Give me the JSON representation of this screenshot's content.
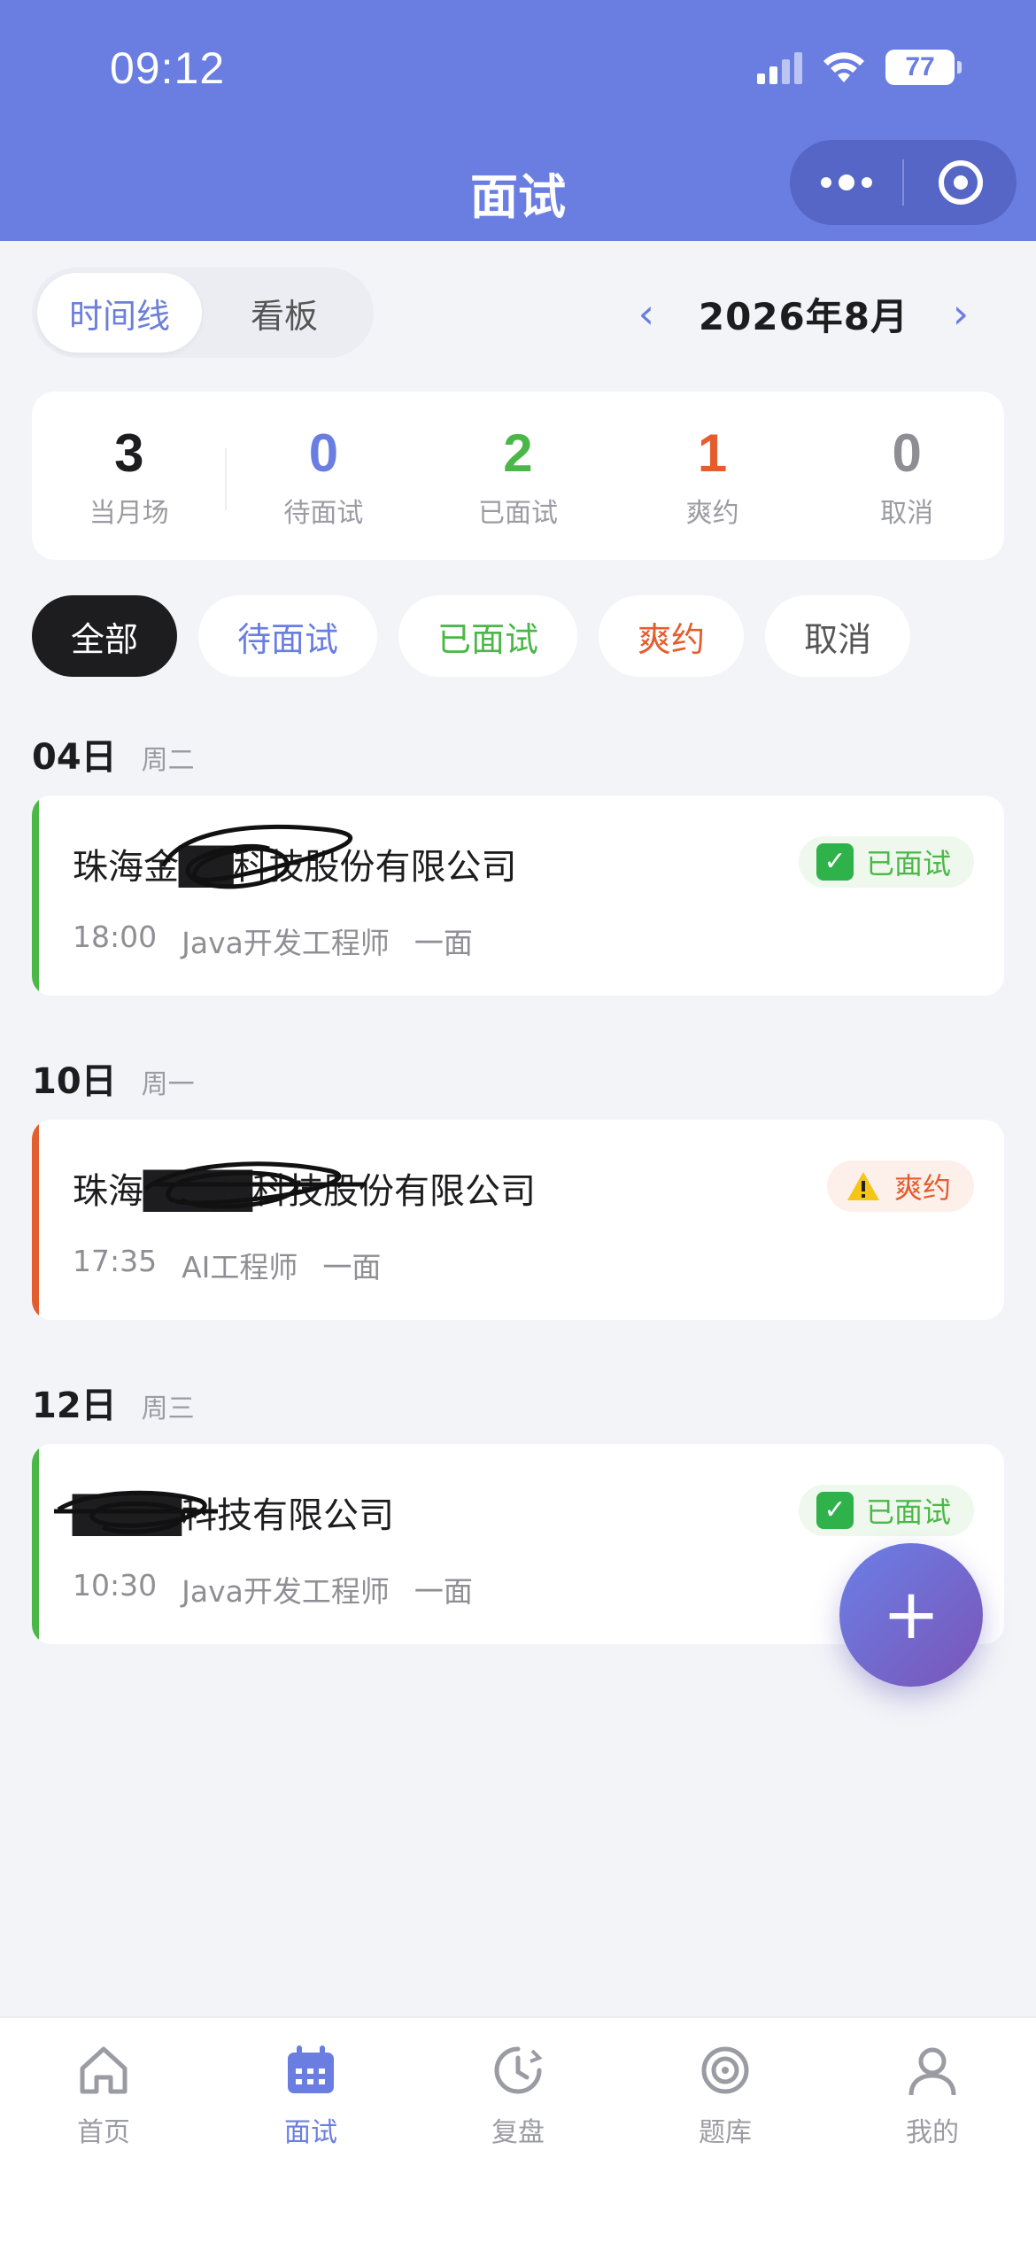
{
  "status_bar": {
    "time": "09:12",
    "battery": "77"
  },
  "header": {
    "title": "面试"
  },
  "view_toggle": {
    "options": [
      "时间线",
      "看板"
    ],
    "active": "时间线"
  },
  "month_nav": {
    "label": "2026年8月",
    "prev": "‹",
    "next": "›"
  },
  "stats": [
    {
      "value": "3",
      "label": "当月场",
      "color": "#1d1d1f"
    },
    {
      "value": "0",
      "label": "待面试",
      "color": "#6a7ee2"
    },
    {
      "value": "2",
      "label": "已面试",
      "color": "#4cb749"
    },
    {
      "value": "1",
      "label": "爽约",
      "color": "#e45d2e"
    },
    {
      "value": "0",
      "label": "取消",
      "color": "#8e8e94"
    }
  ],
  "filters": [
    "全部",
    "待面试",
    "已面试",
    "爽约",
    "取消"
  ],
  "groups": [
    {
      "day": "04日",
      "weekday": "周二",
      "card": {
        "company": "珠海金██科技股份有限公司",
        "time": "18:00",
        "position": "Java开发工程师",
        "round": "一面",
        "status": "已面试",
        "status_icon": "check-icon",
        "accent": "#4cb749"
      }
    },
    {
      "day": "10日",
      "weekday": "周一",
      "card": {
        "company": "珠海████科技股份有限公司",
        "time": "17:35",
        "position": "AI工程师",
        "round": "一面",
        "status": "爽约",
        "status_icon": "warning-icon",
        "accent": "#e45d2e"
      }
    },
    {
      "day": "12日",
      "weekday": "周三",
      "card": {
        "company": "████科技有限公司",
        "time": "10:30",
        "position": "Java开发工程师",
        "round": "一面",
        "status": "已面试",
        "status_icon": "check-icon",
        "accent": "#4cb749"
      }
    }
  ],
  "fab": {
    "label": "+"
  },
  "tabbar": [
    {
      "label": "首页",
      "icon": "home-icon"
    },
    {
      "label": "面试",
      "icon": "calendar-icon",
      "active": true
    },
    {
      "label": "复盘",
      "icon": "review-clock-icon"
    },
    {
      "label": "题库",
      "icon": "target-icon"
    },
    {
      "label": "我的",
      "icon": "user-icon"
    }
  ]
}
